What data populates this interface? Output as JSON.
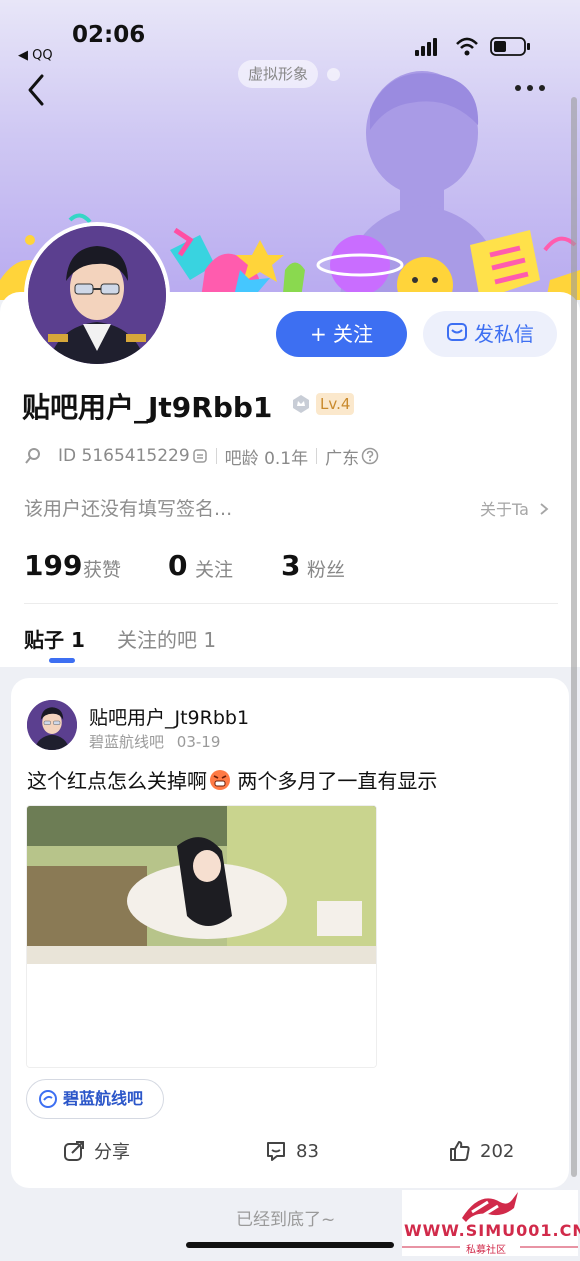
{
  "status_bar": {
    "time": "02:06",
    "back_app": "◀ QQ"
  },
  "header": {
    "avatar_pill": "虚拟形象"
  },
  "profile": {
    "follow_button": "+ 关注",
    "message_button": "发私信",
    "username": "贴吧用户_Jt9Rbb1",
    "level": "Lv.4",
    "id_text": "ID 5165415229",
    "bar_age": "吧龄 0.1年",
    "location": "广东",
    "bio": "该用户还没有填写签名...",
    "about_link": "关于Ta",
    "stats": [
      {
        "num": "199",
        "label": "获赞"
      },
      {
        "num": "0",
        "label": "关注"
      },
      {
        "num": "3",
        "label": "粉丝"
      }
    ]
  },
  "tabs": [
    {
      "label": "贴子 1"
    },
    {
      "label": "关注的吧 1"
    }
  ],
  "post": {
    "author": "贴吧用户_Jt9Rbb1",
    "forum": "碧蓝航线吧",
    "date": "03-19",
    "text_before": "这个红点怎么关掉啊",
    "text_after": " 两个多月了一直有显示",
    "forum_tag": "碧蓝航线吧",
    "share_label": "分享",
    "comments": "83",
    "likes": "202"
  },
  "footer": {
    "end_text": "已经到底了~"
  },
  "watermark": {
    "text": "WWW.SIMU001.CN",
    "sub": "私募社区"
  },
  "colors": {
    "accent": "#3d6ff2",
    "level_bg": "#fbe8cc",
    "level_fg": "#c98a2d"
  }
}
